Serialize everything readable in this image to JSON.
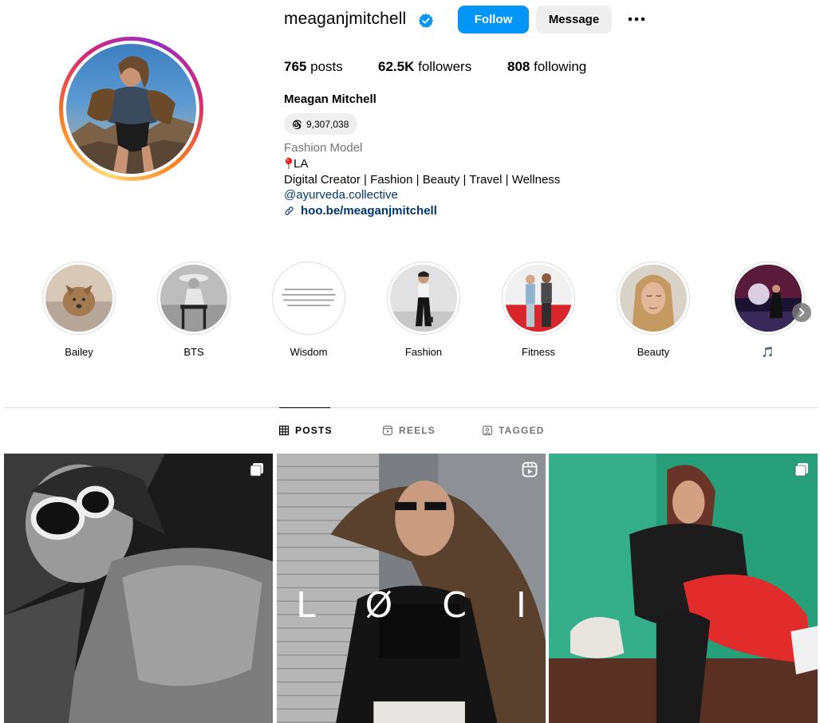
{
  "profile": {
    "username": "meaganjmitchell",
    "full_name": "Meagan Mitchell",
    "verified": true,
    "threads_count": "9,307,038",
    "category": "Fashion Model",
    "location": "LA",
    "description": "Digital Creator | Fashion | Beauty | Travel | Wellness",
    "mention": "@ayurveda.collective",
    "link": "hoo.be/meaganjmitchell"
  },
  "actions": {
    "follow_label": "Follow",
    "message_label": "Message",
    "more_icon": "more-horizontal-icon"
  },
  "stats": {
    "posts_value": "765",
    "posts_label": "posts",
    "followers_value": "62.5K",
    "followers_label": "followers",
    "following_value": "808",
    "following_label": "following"
  },
  "highlights": [
    {
      "label": "Bailey"
    },
    {
      "label": "BTS"
    },
    {
      "label": "Wisdom"
    },
    {
      "label": "Fashion"
    },
    {
      "label": "Fitness"
    },
    {
      "label": "Beauty"
    },
    {
      "label": "🎵"
    }
  ],
  "tabs": [
    {
      "label": "POSTS",
      "icon": "grid-icon",
      "active": true
    },
    {
      "label": "REELS",
      "icon": "reels-icon",
      "active": false
    },
    {
      "label": "TAGGED",
      "icon": "tagged-icon",
      "active": false
    }
  ],
  "posts": [
    {
      "type": "carousel",
      "badge_icon": "carousel-icon"
    },
    {
      "type": "reel",
      "badge_icon": "reel-icon",
      "overlay_text": "L Ø C I"
    },
    {
      "type": "carousel",
      "badge_icon": "carousel-icon"
    }
  ],
  "colors": {
    "follow_button": "#0095f6",
    "secondary_button": "#efefef",
    "link": "#00376b",
    "muted": "#737373",
    "verified": "#0095f6"
  }
}
